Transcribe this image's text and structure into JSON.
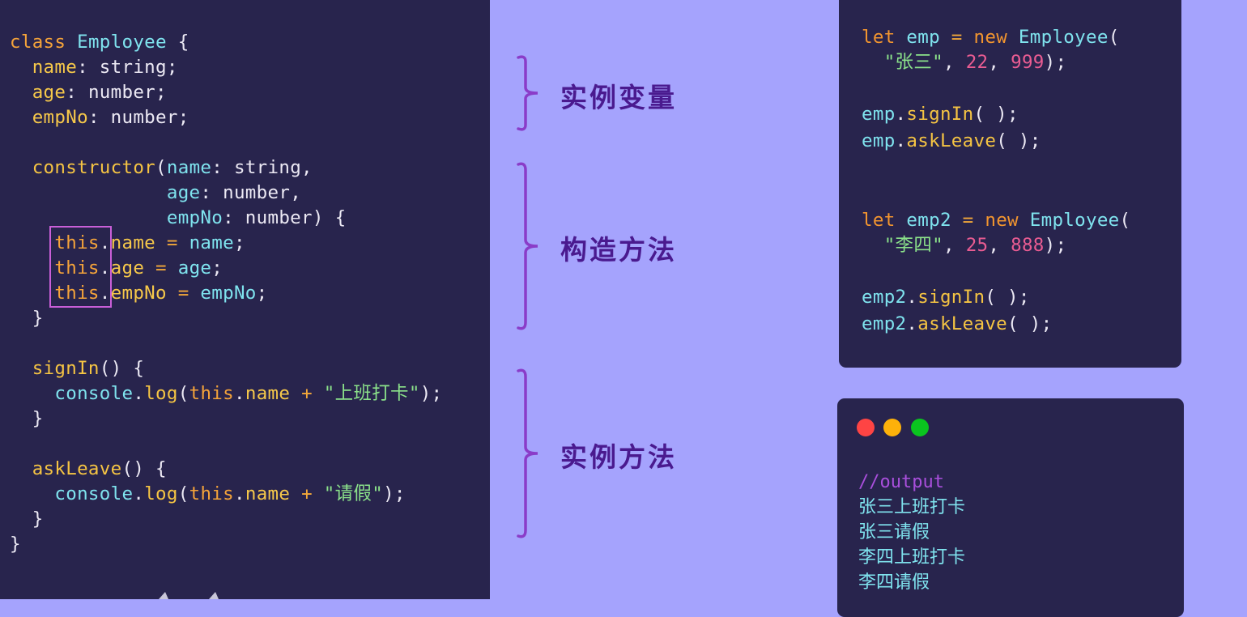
{
  "colors": {
    "background": "#a5a3fd",
    "code_panel": "#28244d",
    "highlight_box": "#c95fd8",
    "brace": "#8a3cc8",
    "label": "#4a1a8f",
    "window_red": "#fe4444",
    "window_yellow": "#fdb10a",
    "window_green": "#0ac51f"
  },
  "class_code": {
    "line1": {
      "kw": "class",
      "name": "Employee",
      "rest": " {"
    },
    "fields": [
      {
        "name": "name",
        "type": "string"
      },
      {
        "name": "age",
        "type": "number"
      },
      {
        "name": "empNo",
        "type": "number"
      }
    ],
    "constructor": {
      "keyword": "constructor",
      "params": [
        {
          "name": "name",
          "type": "string",
          "end": ","
        },
        {
          "name": "age",
          "type": "number",
          "end": ","
        },
        {
          "name": "empNo",
          "type": "number",
          "end": ") {"
        }
      ],
      "assignments": [
        {
          "this": "this",
          "prop": "name",
          "value": "name"
        },
        {
          "this": "this",
          "prop": "age",
          "value": "age"
        },
        {
          "this": "this",
          "prop": "empNo",
          "value": "empNo"
        }
      ],
      "close": "}"
    },
    "methods": [
      {
        "name": "signIn",
        "object": "console",
        "call": "log",
        "this": "this",
        "prop": "name",
        "string": "\"上班打卡\"",
        "close": "}"
      },
      {
        "name": "askLeave",
        "object": "console",
        "call": "log",
        "this": "this",
        "prop": "name",
        "string": "\"请假\"",
        "close": "}"
      }
    ],
    "class_close": "}"
  },
  "annotations": [
    {
      "label": "实例变量"
    },
    {
      "label": "构造方法"
    },
    {
      "label": "实例方法"
    }
  ],
  "usage_code": {
    "instances": [
      {
        "var": "emp",
        "class": "Employee",
        "name_arg": "\"张三\"",
        "age_arg": "22",
        "no_arg": "999"
      },
      {
        "var": "emp2",
        "class": "Employee",
        "name_arg": "\"李四\"",
        "age_arg": "25",
        "no_arg": "888"
      }
    ],
    "kw_let": "let",
    "kw_new": "new",
    "method1": "signIn",
    "method2": "askLeave"
  },
  "output_window": {
    "comment": "//output",
    "lines": [
      "张三上班打卡",
      "张三请假",
      "李四上班打卡",
      "李四请假"
    ]
  }
}
